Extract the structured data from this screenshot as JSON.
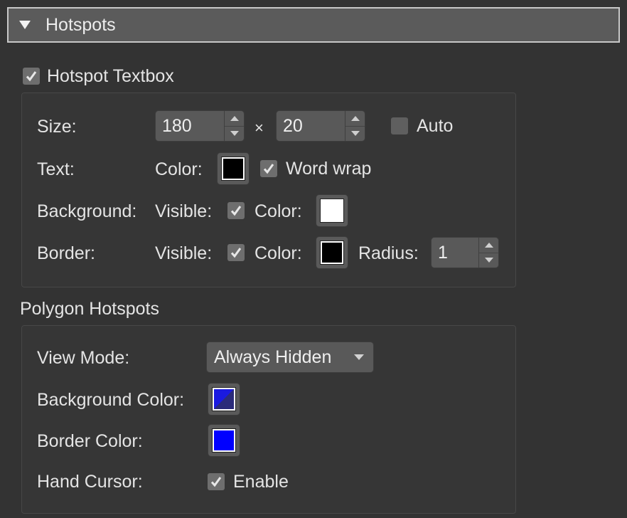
{
  "section": {
    "title": "Hotspots",
    "collapsed": false
  },
  "textbox": {
    "enabled_label": "Hotspot Textbox",
    "enabled": true,
    "size": {
      "label": "Size:",
      "width": "180",
      "separator": "×",
      "height": "20",
      "auto_label": "Auto",
      "auto": false
    },
    "text": {
      "label": "Text:",
      "color_label": "Color:",
      "color": "#000000",
      "word_wrap_label": "Word wrap",
      "word_wrap": true
    },
    "background": {
      "label": "Background:",
      "visible_label": "Visible:",
      "visible": true,
      "color_label": "Color:",
      "color": "#ffffff"
    },
    "border": {
      "label": "Border:",
      "visible_label": "Visible:",
      "visible": true,
      "color_label": "Color:",
      "color": "#000000",
      "radius_label": "Radius:",
      "radius": "1"
    }
  },
  "polygon": {
    "title": "Polygon Hotspots",
    "view_mode": {
      "label": "View Mode:",
      "value": "Always Hidden"
    },
    "background_color": {
      "label": "Background Color:",
      "color": "#1a1ae0",
      "alpha_color": "#2b2b7a"
    },
    "border_color": {
      "label": "Border Color:",
      "color": "#0000ff"
    },
    "hand_cursor": {
      "label": "Hand Cursor:",
      "enable_label": "Enable",
      "enabled": true
    }
  },
  "icons": {
    "collapse": "triangle-down-icon",
    "check": "checkmark-icon",
    "spin_up": "chevron-up-icon",
    "spin_down": "chevron-down-icon",
    "dropdown": "caret-down-icon"
  }
}
